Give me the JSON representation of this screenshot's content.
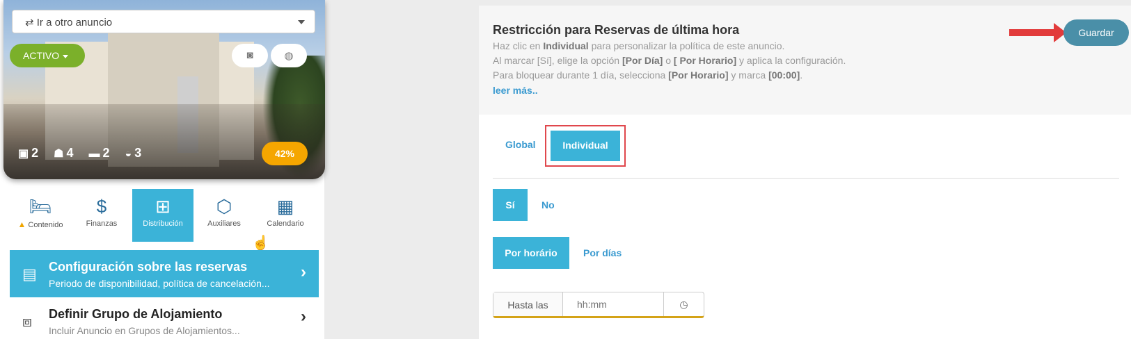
{
  "listing": {
    "goto_label": "⇄ Ir a otro anuncio",
    "status_label": "ACTIVO",
    "stats": [
      {
        "icon": "cube-icon",
        "glyph": "▣",
        "value": "2"
      },
      {
        "icon": "person-icon",
        "glyph": "☗",
        "value": "4"
      },
      {
        "icon": "bed-icon",
        "glyph": "▬",
        "value": "2"
      },
      {
        "icon": "bathtub-icon",
        "glyph": "◒",
        "value": "3"
      }
    ],
    "completion": "42%"
  },
  "nav_tabs": [
    {
      "label": "Contenido",
      "icon": "bed-icon",
      "glyph": "🛏",
      "warning": true
    },
    {
      "label": "Finanzas",
      "icon": "dollar-icon",
      "glyph": "$"
    },
    {
      "label": "Distribución",
      "icon": "sitemap-icon",
      "glyph": "⊞",
      "active": true
    },
    {
      "label": "Auxiliares",
      "icon": "cubes-icon",
      "glyph": "⬡"
    },
    {
      "label": "Calendario",
      "icon": "calendar-icon",
      "glyph": "▦"
    }
  ],
  "menu": {
    "config": {
      "title": "Configuración sobre las reservas",
      "subtitle": "Periodo de disponibilidad, política de cancelación..."
    },
    "group": {
      "title": "Definir Grupo de Alojamiento",
      "subtitle": "Incluir Anuncio en Grupos de Alojamientos..."
    }
  },
  "panel": {
    "title": "Restricción para Reservas de última hora",
    "lines": [
      [
        "Haz clic en ",
        "Individual",
        " para personalizar la política de este anuncio."
      ],
      [
        "Al marcar [Sí], elige la opción ",
        "[Por Día]",
        " o ",
        "[ Por Horario]",
        " y aplica la configuración."
      ],
      [
        "Para bloquear durante 1 día, selecciona ",
        "[Por Horario]",
        " y marca ",
        "[00:00]",
        "."
      ]
    ],
    "read_more": "leer más..",
    "save_label": "Guardar",
    "scope_global": "Global",
    "scope_individual": "Individual",
    "yes_label": "Sí",
    "no_label": "No",
    "by_schedule": "Por horário",
    "by_days": "Por días",
    "until_label": "Hasta las",
    "time_placeholder": "hh:mm"
  },
  "colors": {
    "accent": "#3bb3d8",
    "active_green": "#7bb02a",
    "badge_orange": "#f5a600",
    "highlight_red": "#e0474c",
    "save_teal": "#4a8fa8"
  }
}
